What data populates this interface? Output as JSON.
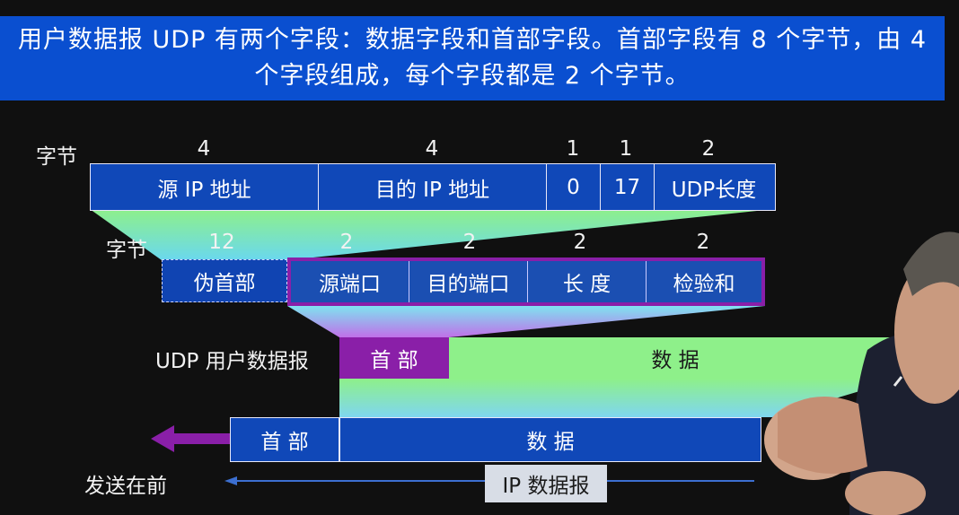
{
  "title": "用户数据报 UDP 有两个字段：数据字段和首部字段。首部字段有 8 个字节，由 4 个字段组成，每个字段都是 2 个字节。",
  "pseudo_header": {
    "bytes_label": "字节",
    "byte_counts": [
      "4",
      "4",
      "1",
      "1",
      "2"
    ],
    "fields": [
      "源 IP 地址",
      "目的 IP 地址",
      "0",
      "17",
      "UDP长度"
    ]
  },
  "udp_header": {
    "bytes_label": "字节",
    "byte_counts": [
      "12",
      "2",
      "2",
      "2",
      "2"
    ],
    "pseudo_label": "伪首部",
    "fields": [
      "源端口",
      "目的端口",
      "长  度",
      "检验和"
    ]
  },
  "udp_datagram": {
    "label": "UDP 用户数据报",
    "header": "首  部",
    "data": "数        据"
  },
  "ip_datagram": {
    "header": "首  部",
    "data": "数        据",
    "label": "IP 数据报",
    "send_first": "发送在前"
  },
  "colors": {
    "title_bg": "#0a4fd0",
    "field_blue": "#1048b8",
    "header_purple": "#8a1fa8",
    "data_green": "#8ef08a",
    "gradient_cyan": "#78e6e6"
  }
}
